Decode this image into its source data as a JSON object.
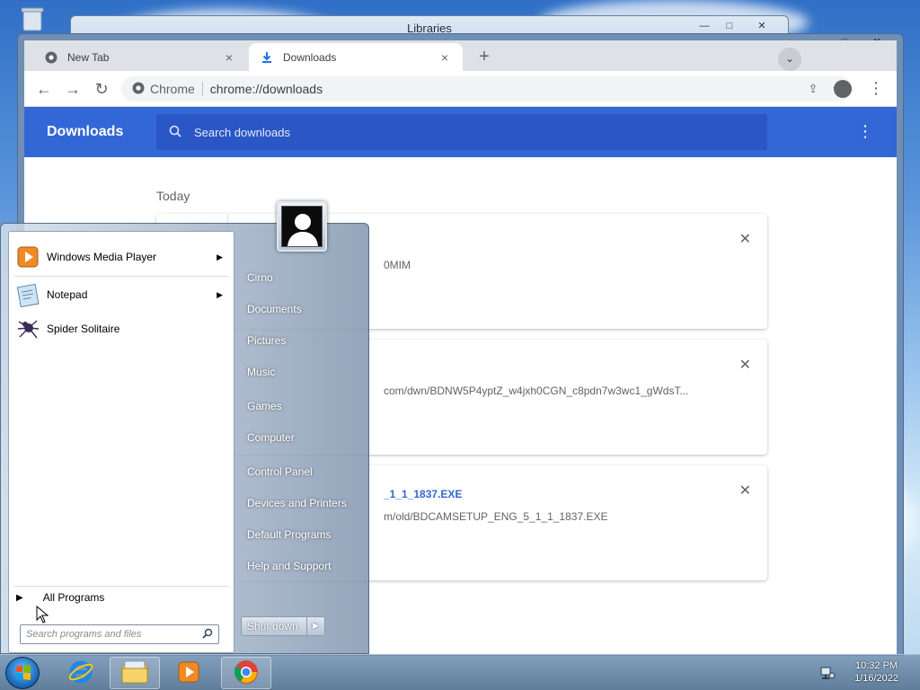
{
  "explorer_window": {
    "title": "Libraries",
    "minimize": "—",
    "maximize": "□",
    "close": "✕"
  },
  "chrome": {
    "tabs": [
      {
        "label": "New Tab",
        "icon": "chrome-icon",
        "active": false
      },
      {
        "label": "Downloads",
        "icon": "download-icon",
        "active": true
      }
    ],
    "tab_close": "×",
    "new_tab": "+",
    "window_controls": {
      "minimize": "—",
      "maximize": "□",
      "close": "✕"
    },
    "omnibox": {
      "site_chip": "Chrome",
      "url": "chrome://downloads"
    },
    "downloads": {
      "title": "Downloads",
      "search_placeholder": "Search downloads",
      "section_label": "Today",
      "items": [
        {
          "filename": "",
          "url": "0MIM"
        },
        {
          "filename": "",
          "url": "com/dwn/BDNW5P4yptZ_w4jxh0CGN_c8pdn7w3wc1_gWdsT..."
        },
        {
          "filename": "_1_1_1837.EXE",
          "url": "m/old/BDCAMSETUP_ENG_5_1_1_1837.EXE"
        }
      ]
    }
  },
  "start_menu": {
    "programs": [
      {
        "label": "Windows Media Player",
        "icon": "media-player-icon",
        "has_submenu": true
      },
      {
        "label": "Notepad",
        "icon": "notepad-icon",
        "has_submenu": true
      },
      {
        "label": "Spider Solitaire",
        "icon": "spider-solitaire-icon",
        "has_submenu": false
      }
    ],
    "all_programs": "All Programs",
    "search_placeholder": "Search programs and files",
    "right_links": [
      "Cirno",
      "Documents",
      "Pictures",
      "Music",
      "Games",
      "Computer",
      "Control Panel",
      "Devices and Printers",
      "Default Programs",
      "Help and Support"
    ],
    "shutdown_label": "Shut down"
  },
  "taskbar": {
    "pinned": [
      "internet-explorer-icon",
      "explorer-folder-icon",
      "media-player-icon",
      "chrome-icon"
    ],
    "clock_time": "10:32 PM",
    "clock_date": "1/16/2022"
  },
  "colors": {
    "chrome_blue": "#3367d6",
    "link_blue": "#3367d6"
  }
}
